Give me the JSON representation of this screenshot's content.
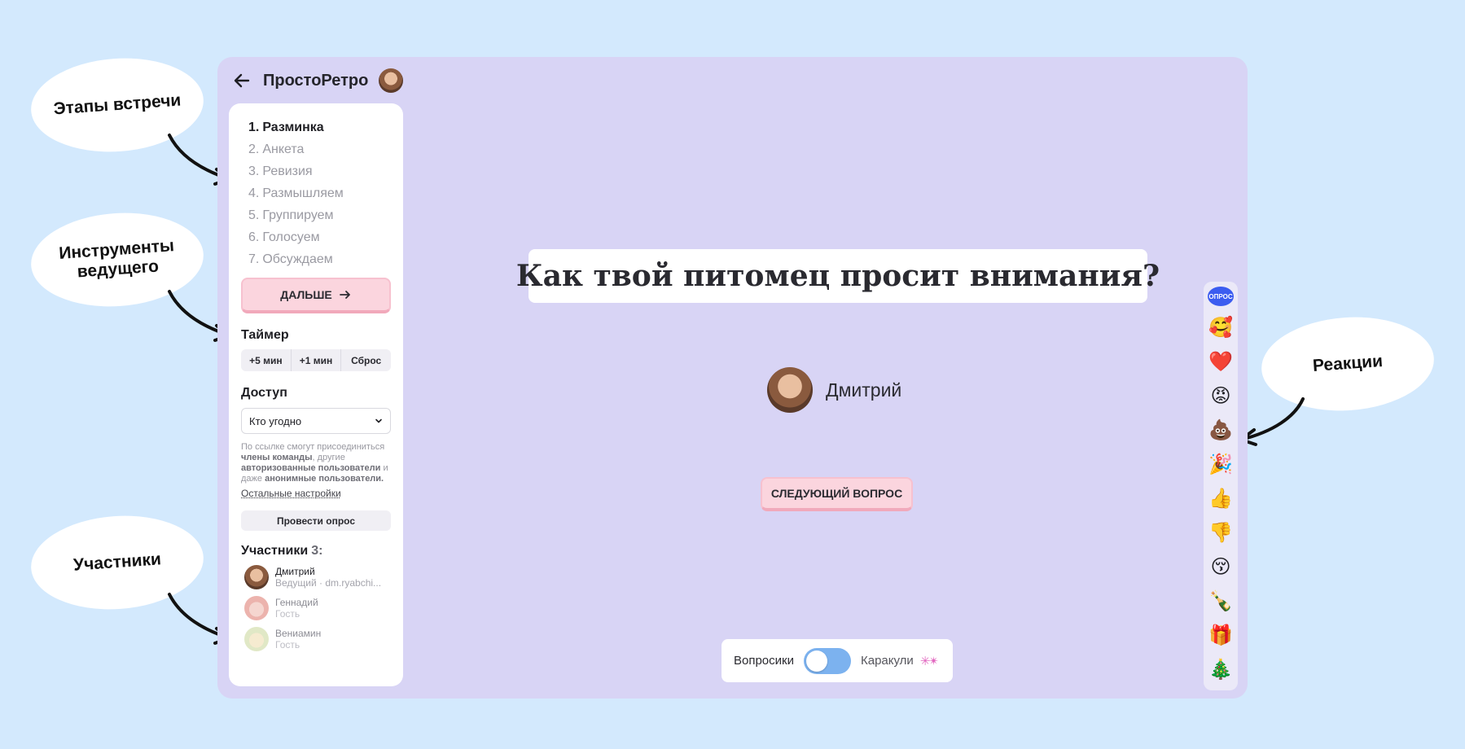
{
  "annotations": {
    "stages": "Этапы встречи",
    "host_tools_line1": "Инструменты",
    "host_tools_line2": "ведущего",
    "participants": "Участники",
    "reactions": "Реакции"
  },
  "header": {
    "title": "ПростоРетро"
  },
  "sidebar": {
    "stages": [
      {
        "num": "1.",
        "label": "Разминка"
      },
      {
        "num": "2.",
        "label": "Анкета"
      },
      {
        "num": "3.",
        "label": "Ревизия"
      },
      {
        "num": "4.",
        "label": "Размышляем"
      },
      {
        "num": "5.",
        "label": "Группируем"
      },
      {
        "num": "6.",
        "label": "Голосуем"
      },
      {
        "num": "7.",
        "label": "Обсуждаем"
      }
    ],
    "next_button": "ДАЛЬШЕ",
    "timer": {
      "title": "Таймер",
      "plus5": "+5 мин",
      "plus1": "+1 мин",
      "reset": "Сброс"
    },
    "access": {
      "title": "Доступ",
      "selected": "Кто угодно",
      "note_p1": "По ссылке смогут присоединиться ",
      "note_b1": "члены команды",
      "note_p2": ", другие ",
      "note_b2": "авторизованные пользователи",
      "note_p3": " и даже ",
      "note_b3": "анонимные пользователи.",
      "settings_link": "Остальные настройки"
    },
    "poll_button": "Провести опрос",
    "participants": {
      "title": "Участники",
      "count": "3:",
      "list": [
        {
          "name": "Дмитрий",
          "role": "Ведущий · dm.ryabchi..."
        },
        {
          "name": "Геннадий",
          "role": "Гость"
        },
        {
          "name": "Вениамин",
          "role": "Гость"
        }
      ]
    }
  },
  "main": {
    "question": "Как твой питомец просит внимания?",
    "speaker_name": "Дмитрий",
    "next_question_button": "СЛЕДУЮЩИЙ ВОПРОС",
    "mode_switch": {
      "left": "Вопросики",
      "right": "Каракули",
      "state": "left"
    }
  },
  "reactions": {
    "poll_badge": "ОПРОС",
    "items": [
      {
        "icon": "smiling-face-with-hearts-icon",
        "glyph": "🥰"
      },
      {
        "icon": "heart-icon",
        "glyph": "❤️"
      },
      {
        "icon": "angry-face-icon",
        "glyph": "😡"
      },
      {
        "icon": "poop-icon",
        "glyph": "💩"
      },
      {
        "icon": "party-popper-icon",
        "glyph": "🎉"
      },
      {
        "icon": "thumbs-up-icon",
        "glyph": "👍"
      },
      {
        "icon": "thumbs-down-icon",
        "glyph": "👎"
      },
      {
        "icon": "kissing-face-icon",
        "glyph": "😚"
      },
      {
        "icon": "champagne-icon",
        "glyph": "🍾"
      },
      {
        "icon": "gift-icon",
        "glyph": "🎁"
      },
      {
        "icon": "christmas-tree-icon",
        "glyph": "🎄"
      }
    ]
  },
  "colors": {
    "background": "#d3e9fd",
    "app_background": "#d8d4f5",
    "accent_pink": "#fbd5de",
    "toggle_blue": "#7cb2ef",
    "poll_badge_blue": "#3b5cf0"
  }
}
